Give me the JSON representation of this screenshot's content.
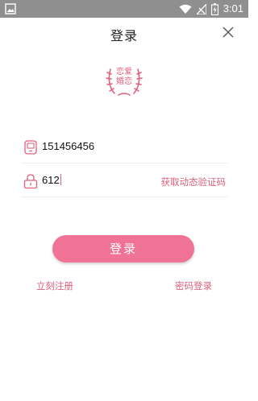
{
  "status_bar": {
    "time": "3:01",
    "icons": [
      "image-icon",
      "wifi-icon",
      "signal-icon",
      "battery-icon"
    ]
  },
  "header": {
    "title": "登录",
    "close_icon": "close-icon"
  },
  "logo": {
    "line1": "恋爱",
    "line2": "婚恋",
    "color": "#e0607e"
  },
  "form": {
    "phone": {
      "icon": "phone-icon",
      "value": "151456456"
    },
    "code": {
      "icon": "lock-icon",
      "value": "612",
      "get_code_label": "获取动态验证码"
    }
  },
  "actions": {
    "login_label": "登录",
    "register_label": "立刻注册",
    "password_login_label": "密码登录"
  },
  "colors": {
    "accent": "#e0607e",
    "button": "#f07396",
    "status_bar": "#8f8f8f"
  }
}
